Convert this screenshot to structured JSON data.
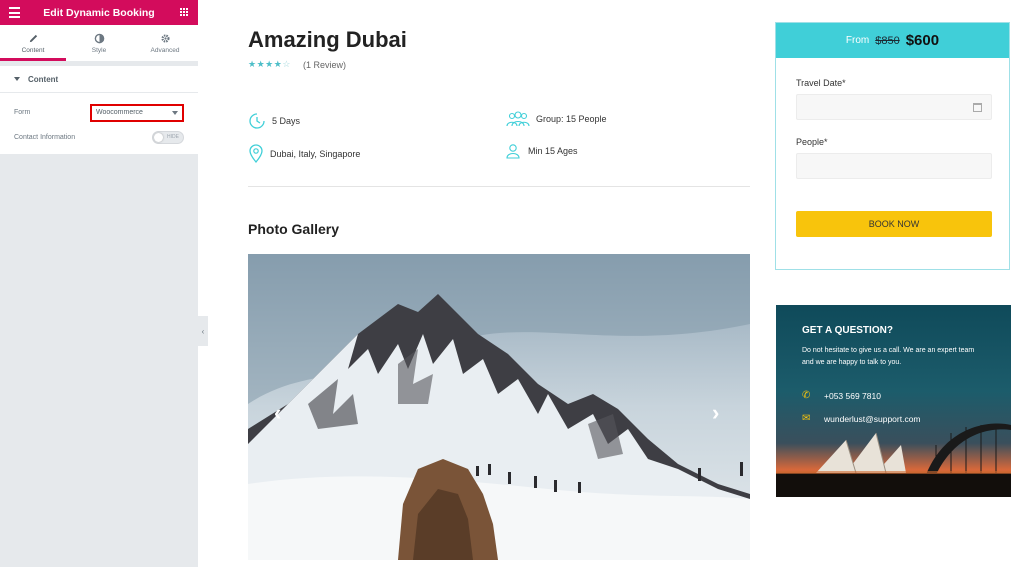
{
  "editor": {
    "title": "Edit Dynamic Booking",
    "tabs": [
      {
        "label": "Content",
        "icon": "pencil-icon"
      },
      {
        "label": "Style",
        "icon": "contrast-icon"
      },
      {
        "label": "Advanced",
        "icon": "gear-icon"
      }
    ],
    "section": "Content",
    "form_label": "Form",
    "form_value": "Woocommerce",
    "contact_label": "Contact Information",
    "toggle_text": "HIDE"
  },
  "tour": {
    "title": "Amazing Dubai",
    "rating": 4,
    "reviews": "(1 Review)",
    "duration": "5 Days",
    "locations": "Dubai, Italy, Singapore",
    "group": "Group: 15 People",
    "min_age": "Min 15 Ages",
    "gallery_title": "Photo Gallery"
  },
  "booking": {
    "from": "From",
    "old_price": "$850",
    "new_price": "$600",
    "date_label": "Travel Date*",
    "people_label": "People*",
    "button": "BOOK NOW"
  },
  "question": {
    "title": "GET A QUESTION?",
    "text": "Do not hesitate to give us a call. We are an expert team and we are happy to talk to you.",
    "phone": "+053 569 7810",
    "email": "wunderlust@support.com"
  },
  "colors": {
    "editor_accent": "#d30c5c",
    "teal": "#40cfd8",
    "button": "#f8c40c"
  }
}
